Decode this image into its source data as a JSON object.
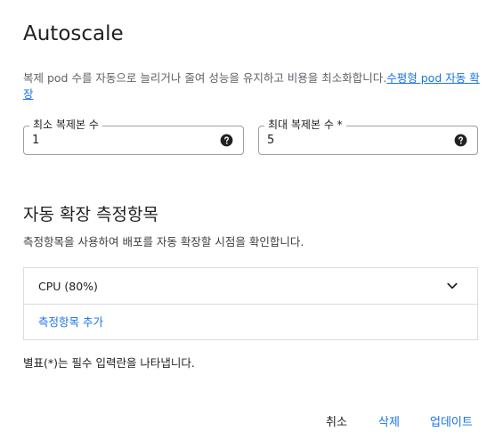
{
  "dialog": {
    "title": "Autoscale",
    "description_text": "복제 pod 수를 자동으로 늘리거나 줄여 성능을 유지하고 비용을 최소화합니다.",
    "description_link": "수평형 pod 자동 확장"
  },
  "fields": {
    "min_replicas": {
      "label": "최소 복제본 수",
      "value": "1",
      "icon": "help-icon"
    },
    "max_replicas": {
      "label": "최대 복제본 수 *",
      "value": "5",
      "icon": "help-icon"
    }
  },
  "metrics": {
    "title": "자동 확장 측정항목",
    "description": "측정항목을 사용하여 배포를 자동 확장할 시점을 확인합니다.",
    "items": [
      {
        "label": "CPU (80%)",
        "icon": "chevron-down-icon"
      }
    ],
    "add_label": "측정항목 추가"
  },
  "footer": {
    "required_note": "별표(*)는 필수 입력란을 나타냅니다.",
    "cancel_label": "취소",
    "delete_label": "삭제",
    "update_label": "업데이트"
  },
  "colors": {
    "accent": "#1a73e8",
    "text": "#202124",
    "muted": "#5f6368",
    "border": "#dadce0"
  }
}
